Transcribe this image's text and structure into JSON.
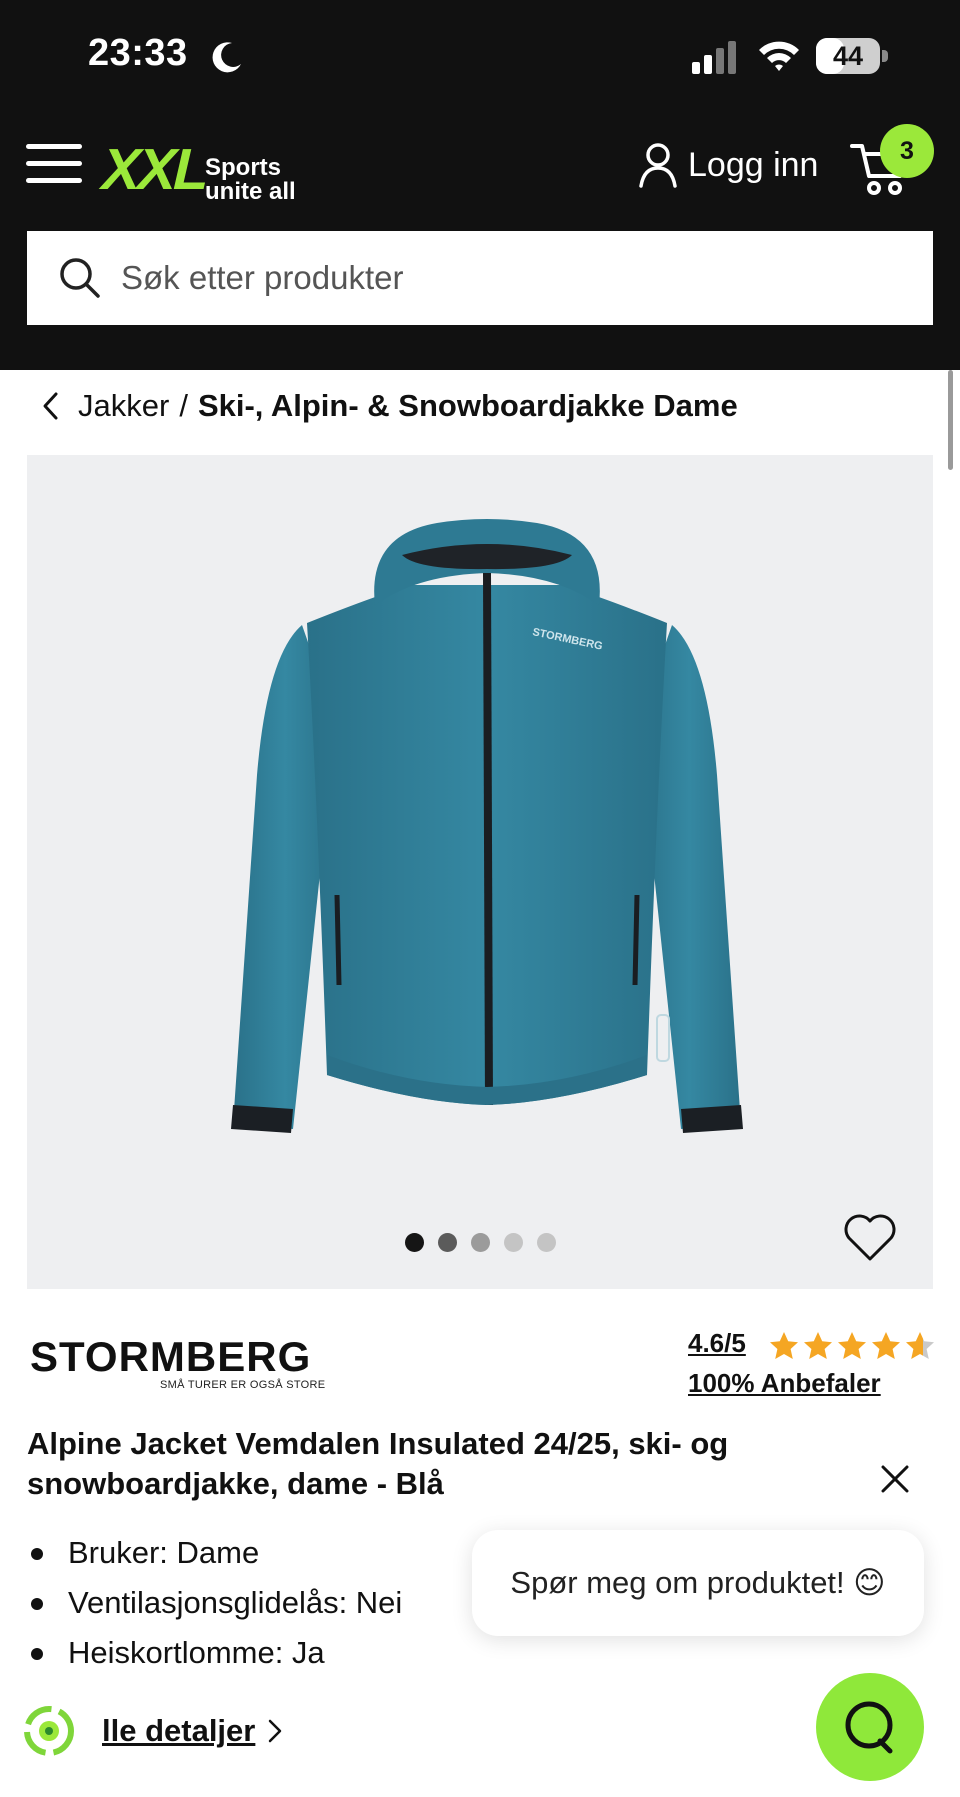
{
  "status_bar": {
    "time": "23:33",
    "battery_percent": "44",
    "battery_level": 0.44
  },
  "header": {
    "logo_text": "XXL",
    "logo_tagline_1": "Sports",
    "logo_tagline_2": "unite all",
    "login_label": "Logg inn",
    "cart_count": "3",
    "search_placeholder": "Søk etter produkter"
  },
  "breadcrumb": {
    "parent": "Jakker",
    "separator": "/",
    "current": "Ski-, Alpin- & Snowboardjakke Dame"
  },
  "gallery": {
    "image_count": 5,
    "active_index": 0,
    "jacket_logo": "STORMBERG"
  },
  "product": {
    "brand_name": "STORMBERG",
    "brand_tagline": "SMÅ TURER ER OGSÅ STORE",
    "rating": "4.6/5",
    "rating_value": 4.6,
    "rating_max": 5,
    "recommend_text": "100% Anbefaler",
    "title": "Alpine Jacket Vemdalen Insulated 24/25, ski- og snowboardjakke, dame - Blå",
    "features": [
      "Bruker: Dame",
      "Ventilasjonsglidelås: Nei",
      "Heiskortlomme: Ja"
    ],
    "details_link": "lle detaljer"
  },
  "chat": {
    "bubble_text": "Spør meg om produktet! 😊"
  },
  "colors": {
    "header_bg": "#111111",
    "brand_green": "#9be83a",
    "star_color": "#f5a623",
    "jacket_blue": "#2f7f98"
  }
}
